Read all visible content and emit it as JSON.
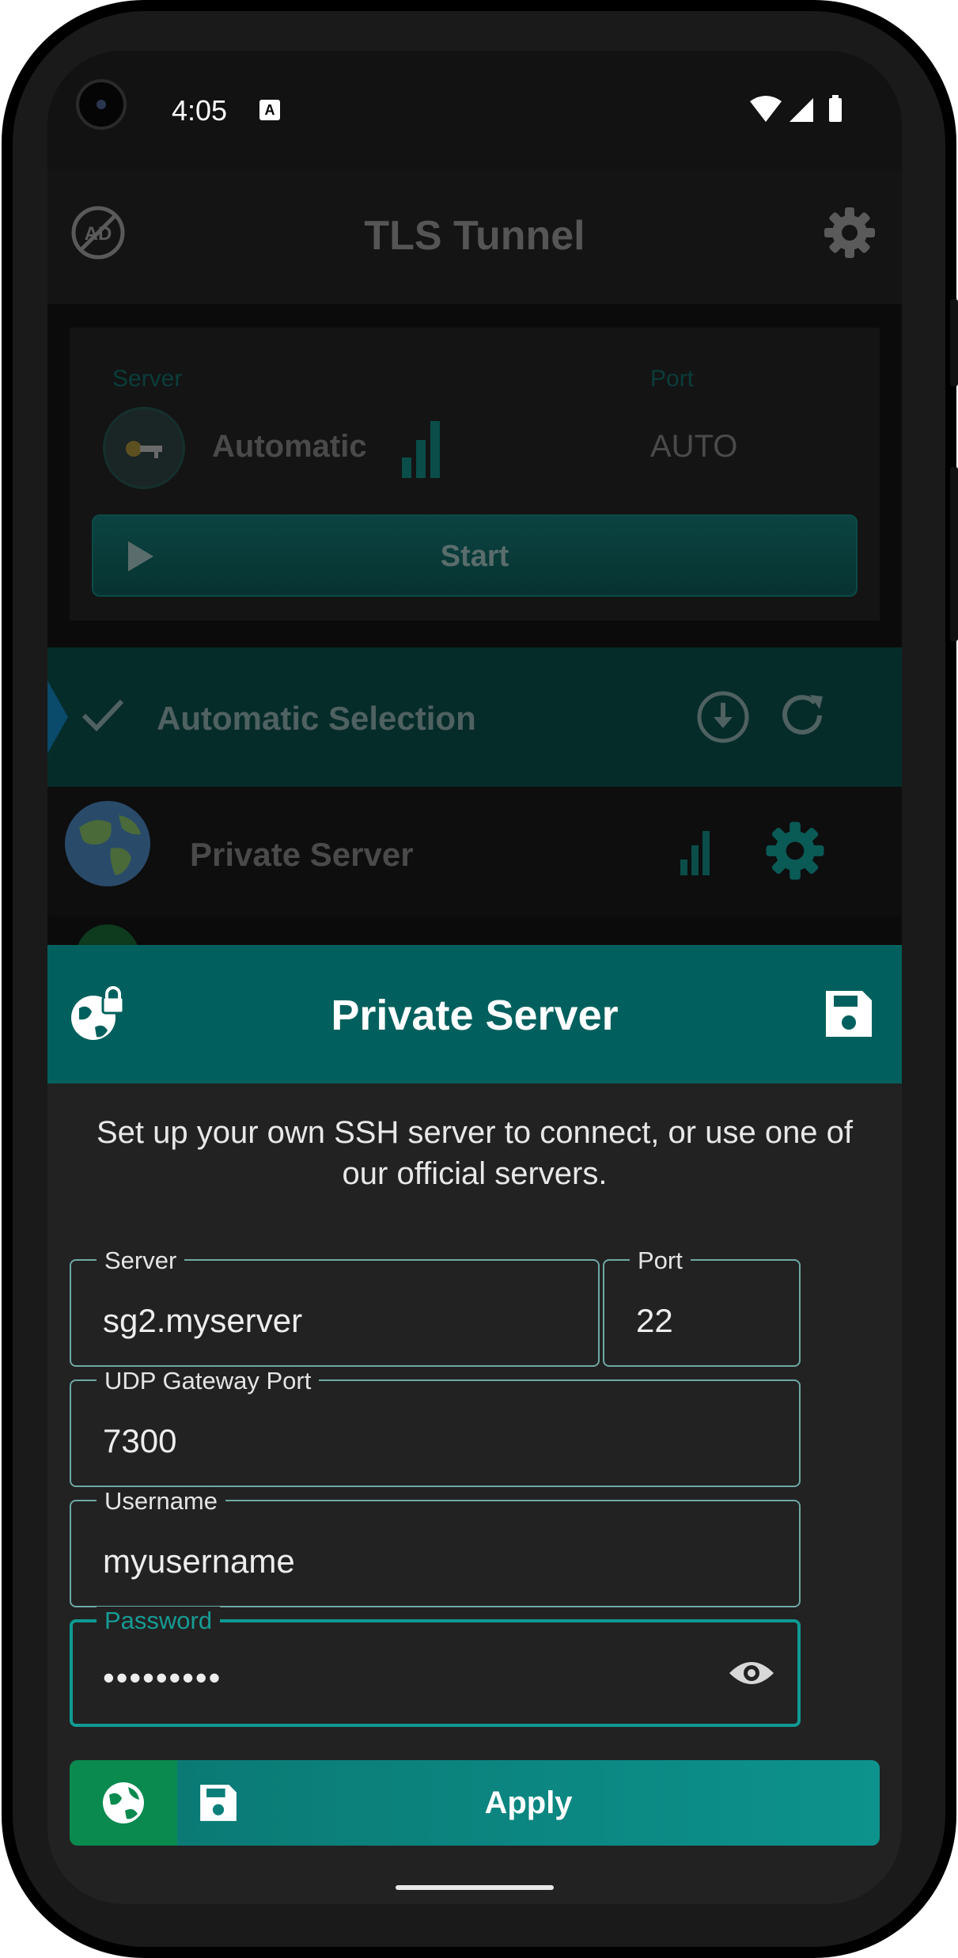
{
  "status_bar": {
    "time": "4:05",
    "notification_icon": "a-icon",
    "icons": [
      "wifi-icon",
      "signal-icon",
      "battery-icon"
    ]
  },
  "app_bar": {
    "title": "TLS Tunnel",
    "left_icon": "ad-off-icon",
    "right_icon": "gear-icon"
  },
  "server_card": {
    "server_label": "Server",
    "port_label": "Port",
    "server_name": "Automatic",
    "port_value": "AUTO",
    "start_label": "Start"
  },
  "server_list": [
    {
      "label": "Automatic Selection",
      "selected": true,
      "icons": [
        "check-icon",
        "download-icon",
        "refresh-icon"
      ]
    },
    {
      "label": "Private Server",
      "selected": false,
      "icons": [
        "globe-icon",
        "signal-icon",
        "gear-icon"
      ]
    }
  ],
  "dialog": {
    "title": "Private Server",
    "description": "Set up your own SSH server to connect, or use one of our official servers.",
    "fields": {
      "server": {
        "label": "Server",
        "value": "sg2.myserver"
      },
      "port": {
        "label": "Port",
        "value": "22"
      },
      "udp": {
        "label": "UDP Gateway Port",
        "value": "7300"
      },
      "username": {
        "label": "Username",
        "value": "myusername"
      },
      "password": {
        "label": "Password",
        "value": "•••••••••"
      }
    },
    "apply_label": "Apply"
  },
  "colors": {
    "accent": "#01605d",
    "dialog_bg": "#222222",
    "focus": "#0f9a93",
    "green": "#0a8a4f"
  }
}
